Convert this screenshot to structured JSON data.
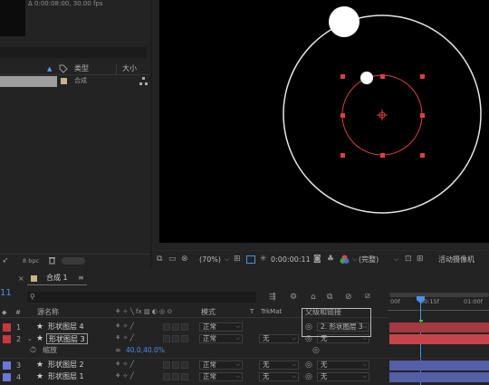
{
  "project": {
    "info_line": "Δ 0:00:08:00, 30.00 fps",
    "col_type": "类型",
    "col_size": "大小",
    "item_type": "合成",
    "bpc": "8 bpc"
  },
  "viewer": {
    "zoom": "(70%)",
    "timecode": "0:00:00:11",
    "quality": "(完整)",
    "camera": "活动摄像机"
  },
  "timeline": {
    "tab_label": "合成 1",
    "frame_digits": "11",
    "col_num": "#",
    "col_source": "源名称",
    "col_mode": "模式",
    "col_t": "T",
    "col_trkmat": "TrkMat",
    "col_parent": "父级和链接",
    "ruler": [
      "00f",
      "00:15f",
      "01:00f"
    ],
    "layers": [
      {
        "num": "1",
        "name": "形状图层 4",
        "mode": "正常",
        "trkmat": "",
        "parent": "2. 形状图层 3",
        "color": "#c8383f"
      },
      {
        "num": "2",
        "name": "形状图层 3",
        "mode": "正常",
        "trkmat": "无",
        "parent": "无",
        "color": "#c8383f"
      },
      {
        "num": "3",
        "name": "形状图层 2",
        "mode": "正常",
        "trkmat": "无",
        "parent": "无",
        "color": "#6a76d8"
      },
      {
        "num": "4",
        "name": "形状图层 1",
        "mode": "正常",
        "trkmat": "无",
        "parent": "无",
        "color": "#6a76d8"
      }
    ],
    "scale_label": "缩放",
    "scale_value": "40.0,40.0%"
  }
}
